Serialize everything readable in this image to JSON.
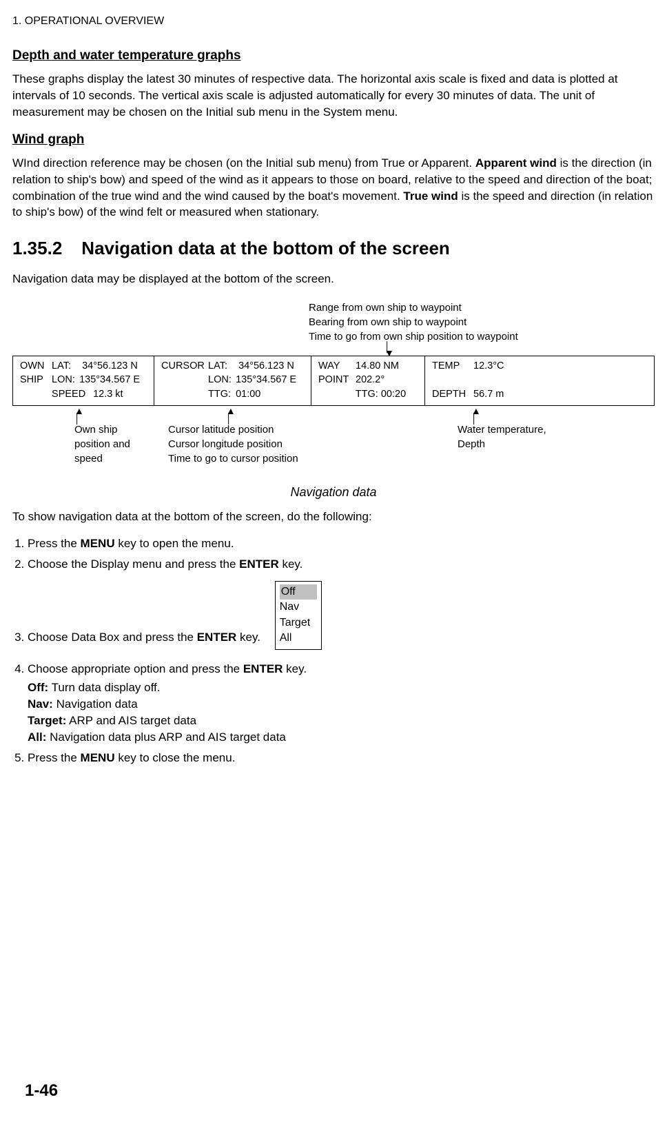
{
  "chapter": "1. OPERATIONAL OVERVIEW",
  "section1": {
    "title": "Depth and water temperature graphs",
    "body": "These graphs display the latest 30 minutes of respective data. The horizontal axis scale is fixed and data is plotted at intervals of 10 seconds. The vertical axis scale is adjusted automatically for every 30 minutes of data. The unit of measurement may be chosen on the Initial sub menu in the System menu."
  },
  "section2": {
    "title": "Wind graph",
    "body_pre": "WInd direction reference may be chosen (on the Initial sub menu) from True or Apparent. ",
    "bold1": "Apparent wind",
    "body_mid": " is the direction (in relation to ship's bow) and speed of the wind as it appears to those on board, relative to the speed and direction of the boat; combination of the true wind and the wind caused by the boat's movement. ",
    "bold2": "True wind",
    "body_post": " is the speed and direction (in relation to ship's bow) of the wind felt or measured when stationary."
  },
  "h2": {
    "num": "1.35.2",
    "title": "Navigation data at the bottom of the screen"
  },
  "intro2": "Navigation data may be displayed at the bottom of the screen.",
  "top_annot": {
    "l1": "Range from own ship to waypoint",
    "l2": "Bearing from own ship to waypoint",
    "l3": "Time to go from own ship position to waypoint"
  },
  "bar": {
    "own": {
      "label": "OWN",
      "label2": "SHIP",
      "lat_lbl": "LAT:",
      "lat": "34°56.123 N",
      "lon_lbl": "LON:",
      "lon": "135°34.567 E",
      "spd_lbl": "SPEED",
      "spd": "12.3 kt"
    },
    "cursor": {
      "label": "CURSOR",
      "lat_lbl": "LAT:",
      "lat": "34°56.123 N",
      "lon_lbl": "LON:",
      "lon": "135°34.567 E",
      "ttg_lbl": "TTG:",
      "ttg": "01:00"
    },
    "way": {
      "label1": "WAY",
      "label2": "POINT",
      "rng": "14.80 NM",
      "brg": "202.2°",
      "ttg_lbl": "TTG:",
      "ttg": "00:20"
    },
    "right": {
      "temp_lbl": "TEMP",
      "temp": "12.3°C",
      "depth_lbl": "DEPTH",
      "depth": "56.7 m"
    }
  },
  "low_annot": {
    "own": {
      "l1": "Own ship",
      "l2": "position and",
      "l3": "speed"
    },
    "cur": {
      "l1": "Cursor latitude position",
      "l2": "Cursor longitude position",
      "l3": "Time to go to cursor position"
    },
    "td": {
      "l1": "Water temperature,",
      "l2": "Depth"
    }
  },
  "caption": "Navigation data",
  "proc_intro": "To show navigation data at the bottom of the screen, do the following:",
  "steps": {
    "s1a": "Press the ",
    "s1b": "MENU",
    "s1c": " key to open the menu.",
    "s2a": "Choose the Display menu and press the ",
    "s2b": "ENTER",
    "s2c": " key.",
    "s3a": "Choose Data Box and press the ",
    "s3b": "ENTER",
    "s3c": " key.",
    "s4a": "Choose appropriate option and press the ",
    "s4b": "ENTER",
    "s4c": " key.",
    "s5a": "Press the ",
    "s5b": "MENU",
    "s5c": " key to close the menu."
  },
  "options": {
    "o1": "Off",
    "o2": "Nav",
    "o3": "Target",
    "o4": "All"
  },
  "optdesc": {
    "off_b": "Off:",
    "off": " Turn data display off.",
    "nav_b": "Nav:",
    "nav": " Navigation data",
    "tgt_b": "Target:",
    "tgt": " ARP and AIS target data",
    "all_b": "All:",
    "all": " Navigation data plus ARP and AIS target data"
  },
  "page": "1-46"
}
